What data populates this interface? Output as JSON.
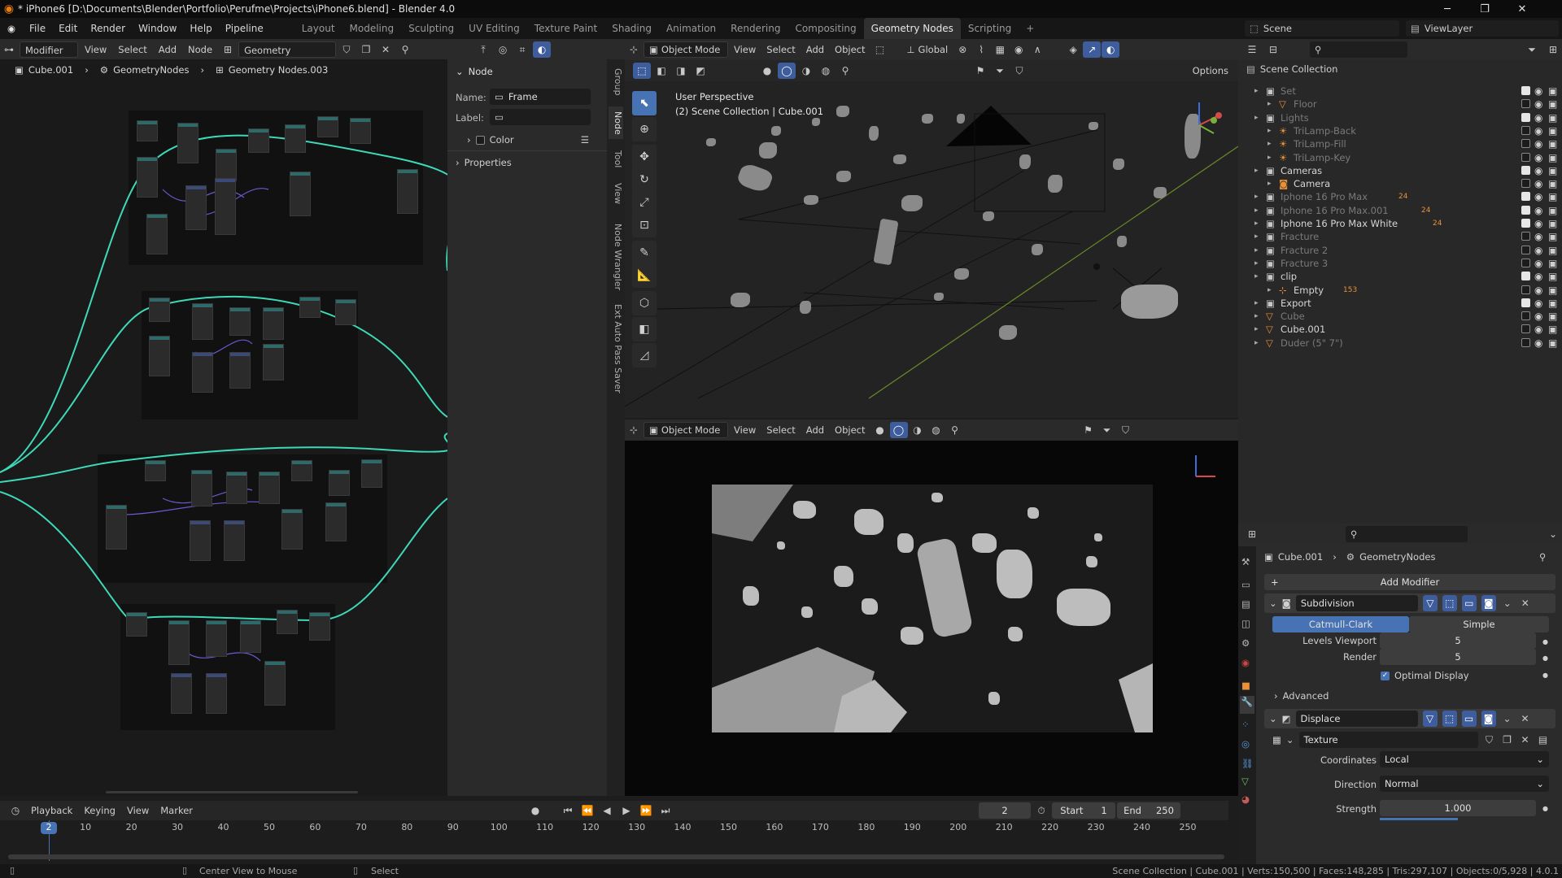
{
  "window": {
    "title": "* iPhone6 [D:\\Documents\\Blender\\Portfolio\\Perufme\\Projects\\iPhone6.blend] - Blender 4.0",
    "controls": [
      "─",
      "❐",
      "✕"
    ]
  },
  "menubar": {
    "items": [
      "File",
      "Edit",
      "Render",
      "Window",
      "Help",
      "Pipeline"
    ],
    "workspaces": [
      "Layout",
      "Modeling",
      "Sculpting",
      "UV Editing",
      "Texture Paint",
      "Shading",
      "Animation",
      "Rendering",
      "Compositing",
      "Geometry Nodes",
      "Scripting"
    ],
    "active_workspace": "Geometry Nodes",
    "add_workspace": "+",
    "scene_label": "Scene",
    "view_layer_label": "ViewLayer"
  },
  "node_editor": {
    "header": {
      "mode": "Modifier",
      "menus": [
        "View",
        "Select",
        "Add",
        "Node"
      ],
      "node_group": "Geometry Nodes.003"
    },
    "breadcrumb": [
      "Cube.001",
      "GeometryNodes",
      "Geometry Nodes.003"
    ]
  },
  "node_panel": {
    "section": "Node",
    "name_label": "Name:",
    "name_value": "Frame",
    "label_label": "Label:",
    "label_value": "",
    "color_label": "Color",
    "properties_label": "Properties",
    "tabs": [
      "Group",
      "Node",
      "Tool",
      "View",
      "Node Wrangler",
      "Ext Auto Pass Saver"
    ],
    "active_tab": "Node"
  },
  "viewport_top": {
    "mode": "Object Mode",
    "menus": [
      "View",
      "Select",
      "Add",
      "Object"
    ],
    "orientation": "Global",
    "options": "Options",
    "overlay_title": "User Perspective",
    "overlay_sub": "(2) Scene Collection | Cube.001"
  },
  "viewport_bottom": {
    "mode": "Object Mode",
    "menus": [
      "View",
      "Select",
      "Add",
      "Object"
    ]
  },
  "outliner": {
    "root": "Scene Collection",
    "rows": [
      {
        "label": "Set",
        "depth": 1,
        "dim": true,
        "check": true
      },
      {
        "label": "Floor",
        "depth": 2,
        "dim": true,
        "check": false
      },
      {
        "label": "Lights",
        "depth": 1,
        "dim": true,
        "check": true
      },
      {
        "label": "TriLamp-Back",
        "depth": 2,
        "dim": true,
        "check": false
      },
      {
        "label": "TriLamp-Fill",
        "depth": 2,
        "dim": true,
        "check": false
      },
      {
        "label": "TriLamp-Key",
        "depth": 2,
        "dim": true,
        "check": false
      },
      {
        "label": "Cameras",
        "depth": 1,
        "dim": false,
        "check": true
      },
      {
        "label": "Camera",
        "depth": 2,
        "dim": false,
        "check": false
      },
      {
        "label": "Iphone 16 Pro Max",
        "depth": 1,
        "dim": true,
        "check": true
      },
      {
        "label": "Iphone 16 Pro Max.001",
        "depth": 1,
        "dim": true,
        "check": true
      },
      {
        "label": "Iphone 16 Pro Max White",
        "depth": 1,
        "dim": false,
        "check": true
      },
      {
        "label": "Fracture",
        "depth": 1,
        "dim": true,
        "check": false
      },
      {
        "label": "Fracture 2",
        "depth": 1,
        "dim": true,
        "check": false
      },
      {
        "label": "Fracture 3",
        "depth": 1,
        "dim": true,
        "check": false
      },
      {
        "label": "clip",
        "depth": 1,
        "dim": false,
        "check": true
      },
      {
        "label": "Empty",
        "depth": 2,
        "dim": false,
        "check": false
      },
      {
        "label": "Export",
        "depth": 1,
        "dim": false,
        "check": true
      },
      {
        "label": "Cube",
        "depth": 1,
        "dim": true,
        "check": false
      },
      {
        "label": "Cube.001",
        "depth": 1,
        "dim": false,
        "check": false
      },
      {
        "label": "Duder (5\" 7\")",
        "depth": 1,
        "dim": true,
        "check": false
      }
    ],
    "badges": {
      "pro_max": "24",
      "pro_max_001": "24",
      "white": "24",
      "empty": "153"
    }
  },
  "properties": {
    "breadcrumb": [
      "Cube.001",
      "GeometryNodes"
    ],
    "add_modifier": "Add Modifier",
    "subdivision": {
      "name": "Subdivision",
      "mode_a": "Catmull-Clark",
      "mode_b": "Simple",
      "levels_viewport_label": "Levels Viewport",
      "levels_viewport": "5",
      "render_label": "Render",
      "render": "5",
      "optimal_display": "Optimal Display",
      "advanced": "Advanced"
    },
    "displace": {
      "name": "Displace",
      "texture_label": "Texture",
      "coordinates_label": "Coordinates",
      "coordinates": "Local",
      "direction_label": "Direction",
      "direction": "Normal",
      "strength_label": "Strength",
      "strength": "1.000"
    }
  },
  "timeline": {
    "menus": [
      "Playback",
      "Keying",
      "View",
      "Marker"
    ],
    "current_frame": "2",
    "start_label": "Start",
    "start": "1",
    "end_label": "End",
    "end": "250",
    "ruler": [
      "10",
      "20",
      "30",
      "40",
      "50",
      "60",
      "70",
      "80",
      "90",
      "100",
      "110",
      "120",
      "130",
      "140",
      "150",
      "160",
      "170",
      "180",
      "190",
      "200",
      "210",
      "220",
      "230",
      "240",
      "250"
    ],
    "playhead_label": "2"
  },
  "statusbar": {
    "hint_center": "Center View to Mouse",
    "hint_select": "Select",
    "stats": "Scene Collection | Cube.001 | Verts:150,500 | Faces:148,285 | Tris:297,107 | Objects:0/5,928 | 4.0.1"
  },
  "colors": {
    "accent": "#4772b3",
    "teal_link": "#3ed9b8",
    "orange_logo": "#e87d0d"
  }
}
